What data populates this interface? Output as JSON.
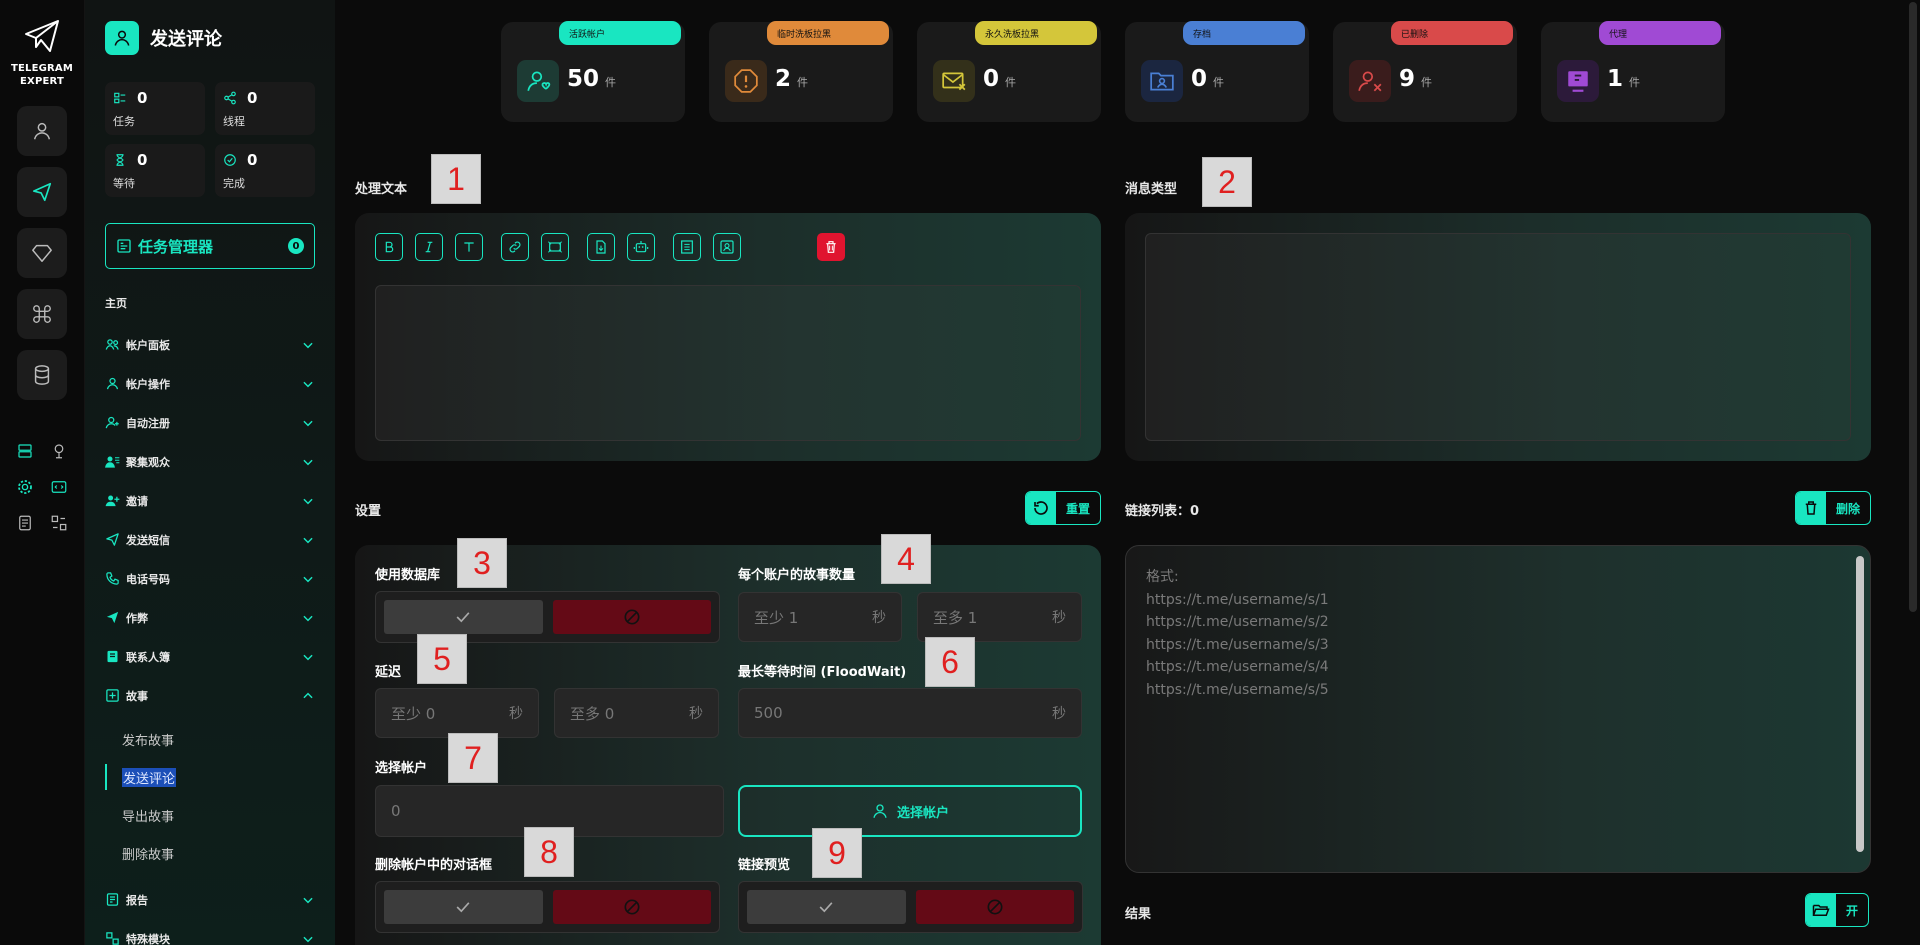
{
  "rail": {
    "brand_line1": "TELEGRAM",
    "brand_line2": "EXPERT",
    "buttons": [
      "user-icon",
      "send-icon",
      "diamond-icon",
      "command-icon",
      "database-icon"
    ],
    "grid_icons": [
      "server-icon",
      "pin-icon",
      "gear-icon",
      "code-icon",
      "doc-icon",
      "swap-icon"
    ]
  },
  "sidebar": {
    "title": "发送评论",
    "stats": [
      {
        "value": "0",
        "label": "任务"
      },
      {
        "value": "0",
        "label": "线程"
      },
      {
        "value": "0",
        "label": "等待"
      },
      {
        "value": "0",
        "label": "完成"
      }
    ],
    "task_manager": {
      "label": "任务管理器",
      "badge": "0"
    },
    "home_label": "主页",
    "menu": [
      {
        "label": "帐户面板",
        "icon": "users-icon"
      },
      {
        "label": "帐户操作",
        "icon": "user-icon"
      },
      {
        "label": "自动注册",
        "icon": "user-plus-icon"
      },
      {
        "label": "聚集观众",
        "icon": "user-list-icon"
      },
      {
        "label": "邀请",
        "icon": "user-add-icon"
      },
      {
        "label": "发送短信",
        "icon": "send-icon"
      },
      {
        "label": "电话号码",
        "icon": "phone-icon"
      },
      {
        "label": "作弊",
        "icon": "rocket-icon"
      },
      {
        "label": "联系人簿",
        "icon": "book-icon"
      },
      {
        "label": "故事",
        "icon": "plus-square-icon",
        "expanded": true,
        "children": [
          "发布故事",
          "发送评论",
          "导出故事",
          "删除故事"
        ]
      },
      {
        "label": "报告",
        "icon": "report-icon"
      },
      {
        "label": "特殊模块",
        "icon": "module-icon"
      }
    ]
  },
  "cards": [
    {
      "tag": "活跃帐户",
      "value": "50",
      "unit": "件",
      "color": "#19e6c1",
      "icon": "user-heart-icon"
    },
    {
      "tag": "临时洗板拉黑",
      "value": "2",
      "unit": "件",
      "color": "#e08a3a",
      "icon": "alert-icon"
    },
    {
      "tag": "永久洗板拉黑",
      "value": "0",
      "unit": "件",
      "color": "#d4c63a",
      "icon": "mail-x-icon"
    },
    {
      "tag": "存档",
      "value": "0",
      "unit": "件",
      "color": "#4a7fd4",
      "icon": "folder-user-icon"
    },
    {
      "tag": "已删除",
      "value": "9",
      "unit": "件",
      "color": "#d94a4a",
      "icon": "user-x-icon"
    },
    {
      "tag": "代理",
      "value": "1",
      "unit": "件",
      "color": "#a04ad4",
      "icon": "proxy-icon"
    }
  ],
  "text_section": {
    "title": "处理文本",
    "annotation": "1"
  },
  "msg_type": {
    "title": "消息类型",
    "annotation": "2"
  },
  "settings": {
    "title": "设置",
    "reset_label": "重置",
    "use_db": {
      "label": "使用数据库",
      "annotation": "3"
    },
    "stories_per_account": {
      "label": "每个账户的故事数量",
      "annotation": "4",
      "min_ph": "至少  1",
      "max_ph": "至多  1",
      "unit": "秒"
    },
    "delay": {
      "label": "延迟",
      "annotation": "5",
      "min_ph": "至少  0",
      "max_ph": "至多  0",
      "unit": "秒"
    },
    "flood_wait": {
      "label": "最长等待时间 (FloodWait)",
      "annotation": "6",
      "value": "500",
      "unit": "秒"
    },
    "select_account": {
      "label": "选择帐户",
      "annotation": "7",
      "value": "0",
      "button": "选择帐户"
    },
    "delete_dialogs": {
      "label": "删除帐户中的对话框",
      "annotation": "8"
    },
    "link_preview": {
      "label": "链接预览",
      "annotation": "9"
    }
  },
  "links": {
    "title": "链接列表：0",
    "delete_label": "删除",
    "placeholder": "格式:\nhttps://t.me/username/s/1\nhttps://t.me/username/s/2\nhttps://t.me/username/s/3\nhttps://t.me/username/s/4\nhttps://t.me/username/s/5"
  },
  "result": {
    "title": "结果",
    "open_label": "开"
  }
}
